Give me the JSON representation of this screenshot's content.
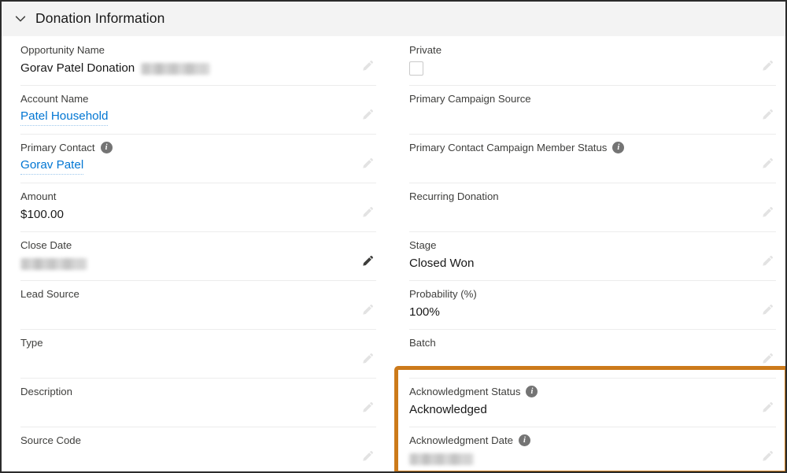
{
  "section": {
    "title": "Donation Information",
    "collapse_icon": "chevron-down-icon",
    "expanded": true
  },
  "icons": {
    "info": "i",
    "edit": "pencil-icon"
  },
  "colors": {
    "highlight_border": "#cc7a1a",
    "link": "#0176d3",
    "header_band": "#f3f3f3",
    "label_text": "#3e3e3c",
    "value_text": "#181818",
    "row_divider": "#ececec"
  },
  "left_column": [
    {
      "label": "Opportunity Name",
      "value": "Gorav Patel Donation",
      "value_type": "text_with_redaction",
      "redacted_suffix": true,
      "redacted_width": 88,
      "has_info": false,
      "edit_state": "light"
    },
    {
      "label": "Account Name",
      "value": "Patel Household",
      "value_type": "link",
      "has_info": false,
      "edit_state": "light"
    },
    {
      "label": "Primary Contact",
      "value": "Gorav Patel",
      "value_type": "link",
      "has_info": true,
      "edit_state": "light"
    },
    {
      "label": "Amount",
      "value": "$100.00",
      "value_type": "text",
      "has_info": false,
      "edit_state": "light"
    },
    {
      "label": "Close Date",
      "value": "",
      "value_type": "redacted",
      "redacted_width": 85,
      "has_info": false,
      "edit_state": "dark"
    },
    {
      "label": "Lead Source",
      "value": "",
      "value_type": "empty",
      "has_info": false,
      "edit_state": "light"
    },
    {
      "label": "Type",
      "value": "",
      "value_type": "empty",
      "has_info": false,
      "edit_state": "light"
    },
    {
      "label": "Description",
      "value": "",
      "value_type": "empty",
      "has_info": false,
      "edit_state": "light"
    },
    {
      "label": "Source Code",
      "value": "",
      "value_type": "empty",
      "has_info": false,
      "edit_state": "light"
    }
  ],
  "right_column": [
    {
      "label": "Private",
      "value": "",
      "value_type": "checkbox",
      "checked": false,
      "has_info": false,
      "edit_state": "light"
    },
    {
      "label": "Primary Campaign Source",
      "value": "",
      "value_type": "empty",
      "has_info": false,
      "edit_state": "light"
    },
    {
      "label": "Primary Contact Campaign Member Status",
      "value": "",
      "value_type": "empty",
      "has_info": true,
      "edit_state": "light"
    },
    {
      "label": "Recurring Donation",
      "value": "",
      "value_type": "empty",
      "has_info": false,
      "edit_state": "light"
    },
    {
      "label": "Stage",
      "value": "Closed Won",
      "value_type": "text",
      "has_info": false,
      "edit_state": "light"
    },
    {
      "label": "Probability (%)",
      "value": "100%",
      "value_type": "text",
      "has_info": false,
      "edit_state": "light"
    },
    {
      "label": "Batch",
      "value": "",
      "value_type": "empty",
      "has_info": false,
      "edit_state": "light"
    },
    {
      "label": "Acknowledgment Status",
      "value": "Acknowledged",
      "value_type": "text",
      "has_info": true,
      "edit_state": "light",
      "highlighted": true
    },
    {
      "label": "Acknowledgment Date",
      "value": "",
      "value_type": "redacted",
      "redacted_width": 82,
      "has_info": true,
      "edit_state": "light",
      "highlighted": true
    }
  ]
}
